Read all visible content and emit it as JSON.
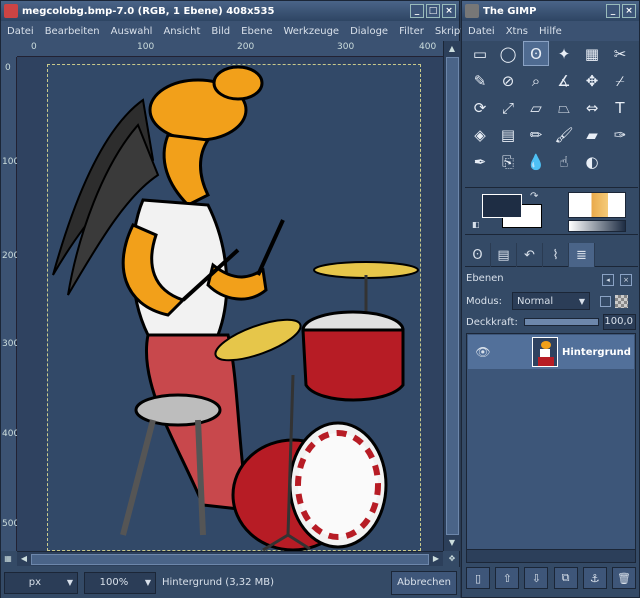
{
  "image_window": {
    "title": "megcolobg.bmp-7.0 (RGB, 1 Ebene) 408x535",
    "menu": [
      "Datei",
      "Bearbeiten",
      "Auswahl",
      "Ansicht",
      "Bild",
      "Ebene",
      "Werkzeuge",
      "Dialoge",
      "Filter",
      "Skript-Fu"
    ],
    "hruler_labels": [
      "0",
      "100",
      "200",
      "300",
      "400"
    ],
    "vruler_labels": [
      "0",
      "100",
      "200",
      "300",
      "400",
      "500"
    ],
    "status": {
      "unit": "px",
      "zoom": "100%",
      "info": "Hintergrund (3,32 MB)",
      "abort_label": "Abbrechen"
    }
  },
  "toolbox": {
    "title": "The GIMP",
    "menu": [
      "Datei",
      "Xtns",
      "Hilfe"
    ],
    "tools": [
      {
        "name": "rect-select-icon",
        "glyph": "▭"
      },
      {
        "name": "ellipse-select-icon",
        "glyph": "◯"
      },
      {
        "name": "lasso-icon",
        "glyph": "ʘ"
      },
      {
        "name": "fuzzy-select-icon",
        "glyph": "✦"
      },
      {
        "name": "by-color-select-icon",
        "glyph": "▦"
      },
      {
        "name": "scissors-icon",
        "glyph": "✂"
      },
      {
        "name": "paths-icon",
        "glyph": "✎"
      },
      {
        "name": "color-picker-icon",
        "glyph": "⊘"
      },
      {
        "name": "magnify-icon",
        "glyph": "⌕"
      },
      {
        "name": "measure-icon",
        "glyph": "∡"
      },
      {
        "name": "move-icon",
        "glyph": "✥"
      },
      {
        "name": "crop-icon",
        "glyph": "⌿"
      },
      {
        "name": "rotate-icon",
        "glyph": "⟳"
      },
      {
        "name": "scale-icon",
        "glyph": "⤢"
      },
      {
        "name": "shear-icon",
        "glyph": "▱"
      },
      {
        "name": "perspective-icon",
        "glyph": "⏢"
      },
      {
        "name": "flip-icon",
        "glyph": "⇔"
      },
      {
        "name": "text-icon",
        "glyph": "T"
      },
      {
        "name": "bucket-fill-icon",
        "glyph": "◈"
      },
      {
        "name": "blend-icon",
        "glyph": "▤"
      },
      {
        "name": "pencil-icon",
        "glyph": "✏"
      },
      {
        "name": "paintbrush-icon",
        "glyph": "🖌"
      },
      {
        "name": "eraser-icon",
        "glyph": "▰"
      },
      {
        "name": "airbrush-icon",
        "glyph": "✑"
      },
      {
        "name": "ink-icon",
        "glyph": "✒"
      },
      {
        "name": "clone-icon",
        "glyph": "⎘"
      },
      {
        "name": "blur-icon",
        "glyph": "💧"
      },
      {
        "name": "smudge-icon",
        "glyph": "☝"
      },
      {
        "name": "dodge-burn-icon",
        "glyph": "◐"
      }
    ],
    "active_tool": 2
  },
  "layers_dock": {
    "title": "Ebenen",
    "mode_label": "Modus:",
    "mode_value": "Normal",
    "opacity_label": "Deckkraft:",
    "opacity_value": "100,0",
    "opacity_fraction": 1.0,
    "layers": [
      {
        "name": "Hintergrund",
        "visible": true
      }
    ]
  },
  "colors": {
    "foreground": "#1e2d44",
    "background": "#ffffff",
    "image_bg": "#324968"
  }
}
